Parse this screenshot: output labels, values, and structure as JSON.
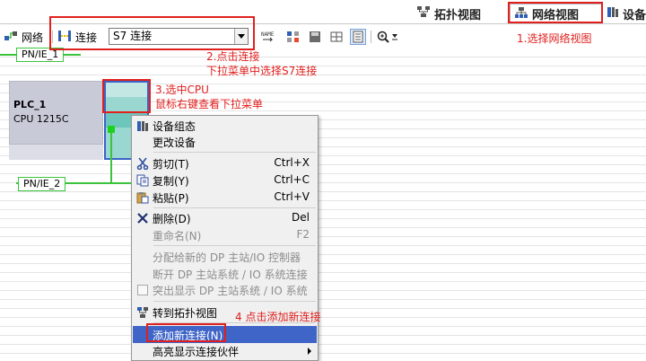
{
  "tabs": {
    "topology_label": "拓扑视图",
    "network_label": "网络视图",
    "device_label": "设备"
  },
  "toolbar": {
    "network_label": "网络",
    "connect_label": "连接",
    "connection_type": "S7 连接"
  },
  "canvas": {
    "subnet1": "PN/IE_1",
    "subnet2": "PN/IE_2",
    "plc_name": "PLC_1",
    "plc_type": "CPU 1215C"
  },
  "annotations": {
    "step1": "1.选择网络视图",
    "step2_line1": "2.点击连接",
    "step2_line2": "下拉菜单中选择S7连接",
    "step3_line1": "3.选中CPU",
    "step3_line2": "鼠标右键查看下拉菜单",
    "step4": "4 点击添加新连接"
  },
  "context_menu": {
    "items": [
      {
        "label": "设备组态",
        "shortcut": "",
        "icon": "device-config-icon"
      },
      {
        "label": "更改设备",
        "shortcut": ""
      },
      {
        "label": "剪切(T)",
        "shortcut": "Ctrl+X",
        "icon": "scissors-icon"
      },
      {
        "label": "复制(Y)",
        "shortcut": "Ctrl+C",
        "icon": "copy-icon"
      },
      {
        "label": "粘贴(P)",
        "shortcut": "Ctrl+V",
        "icon": "paste-icon"
      },
      {
        "label": "删除(D)",
        "shortcut": "Del",
        "icon": "delete-icon"
      },
      {
        "label": "重命名(N)",
        "shortcut": "F2",
        "disabled": true
      },
      {
        "label": "分配给新的 DP 主站/IO 控制器",
        "disabled": true
      },
      {
        "label": "断开 DP 主站系统 / IO 系统连接",
        "disabled": true
      },
      {
        "label": "突出显示 DP 主站系统 / IO 系统",
        "disabled": true,
        "checkbox": true
      },
      {
        "label": "转到拓扑视图",
        "icon": "topology-icon"
      },
      {
        "label": "添加新连接(N)",
        "highlighted": true
      },
      {
        "label": "高亮显示连接伙伴",
        "submenu": true
      }
    ]
  },
  "colors": {
    "annotation_red": "#e0201e",
    "subnet_green": "#3cc33c",
    "menu_highlight": "#3f65c8",
    "plc_body": "#c9cad8",
    "module_teal": "#9ad7d0"
  }
}
